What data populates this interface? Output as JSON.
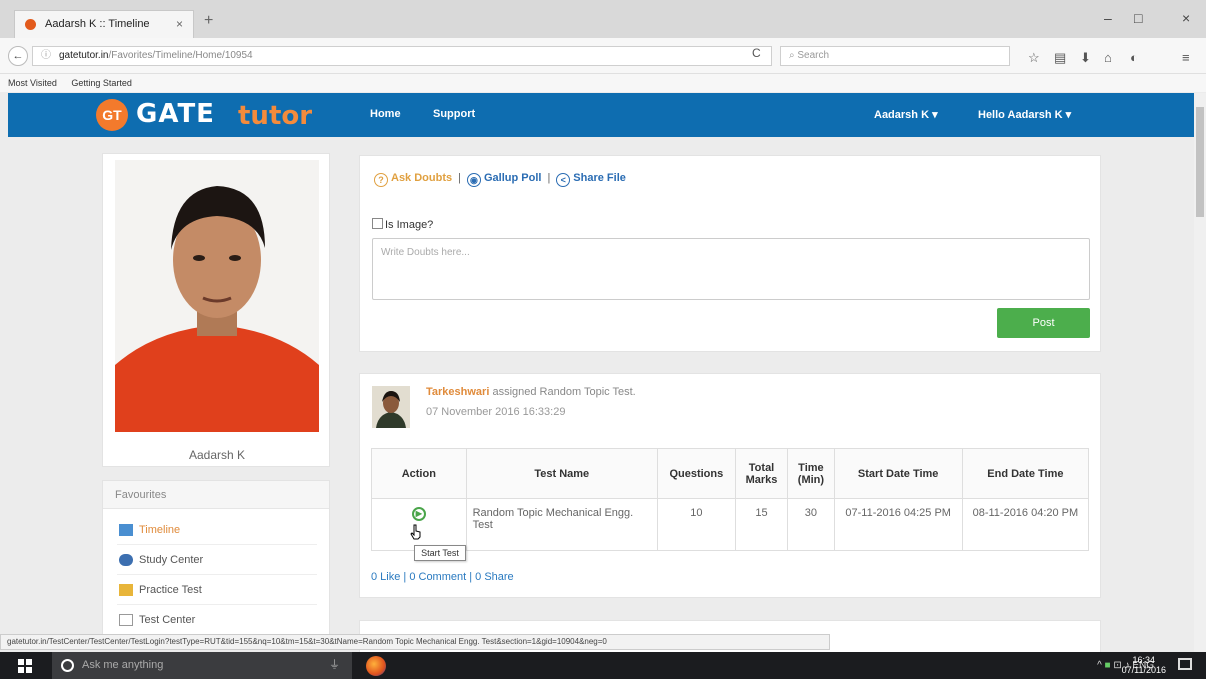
{
  "browser": {
    "tab_title": "Aadarsh K :: Timeline",
    "tab_close": "×",
    "new_tab": "+",
    "back": "←",
    "url_host": "gatetutor.in",
    "url_path": "/Favorites/Timeline/Home/10954",
    "reload": "C",
    "search_placeholder": "Search",
    "window_controls": [
      "–",
      "□",
      "×"
    ],
    "bookmarks": [
      "Most Visited",
      "Getting Started"
    ]
  },
  "site": {
    "logo_badge": "GT",
    "logo_main": "GATE",
    "logo_accent": "tutor",
    "nav": [
      "Home",
      "Support"
    ],
    "user_menu": "Aadarsh K ▾",
    "hello_menu": "Hello Aadarsh K ▾"
  },
  "profile": {
    "name": "Aadarsh K"
  },
  "favourites": {
    "heading": "Favourites",
    "items": [
      "Timeline",
      "Study Center",
      "Practice Test",
      "Test Center"
    ]
  },
  "post_box": {
    "option_ask": "Ask Doubts",
    "option_poll": "Gallup Poll",
    "option_share": "Share File",
    "separator": "|",
    "is_image_label": "Is Image?",
    "placeholder": "Write Doubts here...",
    "post_button": "Post"
  },
  "feed": {
    "author": "Tarkeshwari",
    "action": " assigned Random Topic Test.",
    "datetime": "07 November 2016 16:33:29",
    "table": {
      "headers": [
        "Action",
        "Test Name",
        "Questions",
        "Total Marks",
        "Time (Min)",
        "Start Date Time",
        "End Date Time"
      ],
      "row": {
        "test_name": "Random Topic Mechanical Engg. Test",
        "questions": "10",
        "total_marks": "15",
        "time": "30",
        "start": "07-11-2016 04:25 PM",
        "end": "08-11-2016 04:20 PM"
      }
    },
    "tooltip": "Start Test",
    "social": "0 Like | 0 Comment | 0 Share"
  },
  "status_url": "gatetutor.in/TestCenter/TestCenter/TestLogin?testType=RUT&tid=155&nq=10&tm=15&t=30&tName=Random Topic Mechanical Engg. Test&section=1&gid=10904&neg=0",
  "taskbar": {
    "search": "Ask me anything",
    "lang": "ENG",
    "time": "16:34",
    "date": "07/11/2016"
  },
  "colors": {
    "site_header": "#0e6db0",
    "logo_accent": "#f38b3c",
    "post_button": "#4cae4c",
    "link": "#2a7ac0"
  }
}
